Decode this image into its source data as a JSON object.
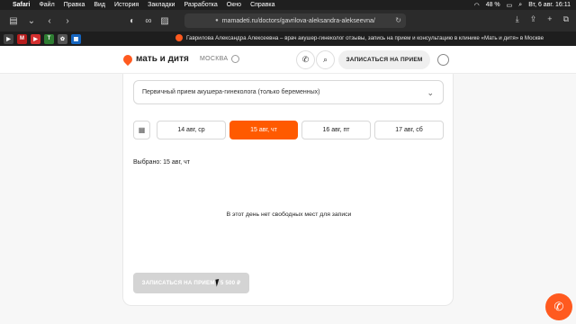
{
  "menubar": {
    "app": "Safari",
    "items": [
      "Файл",
      "Правка",
      "Вид",
      "История",
      "Закладки",
      "Разработка",
      "Окно",
      "Справка"
    ],
    "battery": "48 %",
    "datetime": "Вт, 6 авг.  16:11"
  },
  "browser": {
    "url": "mamadeti.ru/doctors/gavrilova-aleksandra-alekseevna/",
    "tab_title": "Гаврилова Александра Алексеевна – врач акушер-гинеколог отзывы, запись на прием и консультацию в клинике «Мать и дитя» в Москве"
  },
  "site": {
    "logo": "мать и дитя",
    "city": "МОСКВА",
    "cta": "ЗАПИСАТЬСЯ НА ПРИЕМ"
  },
  "booking": {
    "service": "Первичный прием акушера-гинеколога (только беременных)",
    "days": [
      {
        "label": "14 авг, ср",
        "active": false
      },
      {
        "label": "15 авг, чт",
        "active": true
      },
      {
        "label": "16 авг, пт",
        "active": false
      },
      {
        "label": "17 авг, сб",
        "active": false
      }
    ],
    "selected": "Выбрано: 15 авг, чт",
    "empty_message": "В этот день нет свободных мест для записи",
    "submit": "ЗАПИСАТЬСЯ НА ПРИЕМ · 5 500 ₽"
  },
  "colors": {
    "accent": "#ff5a00"
  }
}
